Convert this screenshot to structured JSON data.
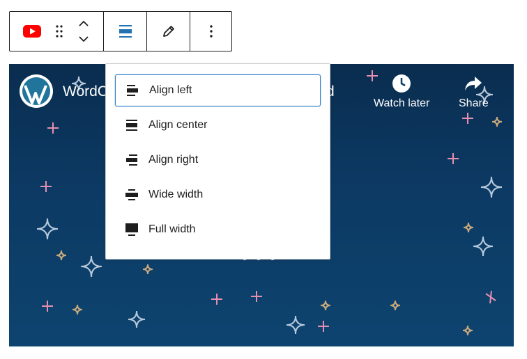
{
  "toolbar": {
    "groups": [
      {
        "items": [
          "youtube-icon",
          "drag-handle-icon",
          "move-up-down-icon"
        ]
      },
      {
        "items": [
          "align-icon"
        ]
      },
      {
        "items": [
          "pencil-icon"
        ]
      },
      {
        "items": [
          "more-options-icon"
        ]
      }
    ],
    "colors": {
      "youtube_red": "#ff0000",
      "active_blue": "#2271b1",
      "border": "#1e1e1e"
    }
  },
  "video": {
    "title_visible_start": "WordC",
    "title_visible_end": "d",
    "watch_later_label": "Watch later",
    "share_label": "Share",
    "background_color": "#0c3a64"
  },
  "align_menu": {
    "items": [
      {
        "label": "Align left",
        "icon": "align-left-icon",
        "selected": true
      },
      {
        "label": "Align center",
        "icon": "align-center-icon",
        "selected": false
      },
      {
        "label": "Align right",
        "icon": "align-right-icon",
        "selected": false
      },
      {
        "label": "Wide width",
        "icon": "align-wide-icon",
        "selected": false
      },
      {
        "label": "Full width",
        "icon": "align-full-width-icon",
        "selected": false
      }
    ],
    "focus_color": "#3582c4"
  }
}
